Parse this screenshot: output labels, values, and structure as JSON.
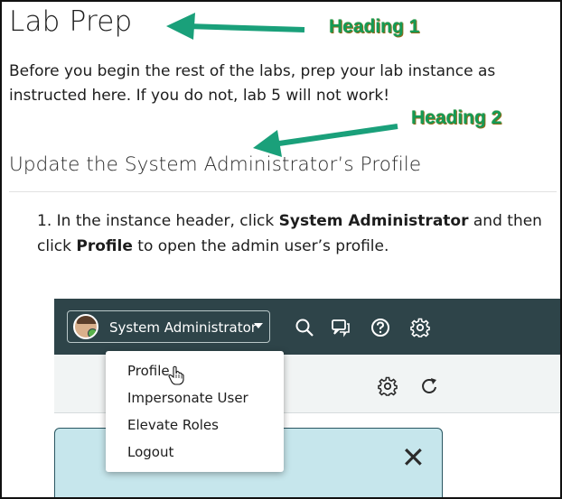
{
  "page": {
    "heading1": "Lab Prep",
    "intro": "Before you begin the rest of the labs, prep your lab instance as instructed here. If you do not, lab 5 will not work!",
    "heading2": "Update the System Administrator’s Profile",
    "step": {
      "number": "1.",
      "text_1": "In the instance header, click ",
      "bold_1": "System Administrator",
      "text_2": " and then click ",
      "bold_2": "Profile",
      "text_3": " to open the admin user’s profile."
    }
  },
  "callouts": {
    "heading1": "Heading 1",
    "heading2": "Heading 2",
    "arrow_color": "#1aa07a",
    "text_color": "#149a55"
  },
  "screenshot": {
    "user_label": "System Administrator",
    "header_bg": "#2e4449",
    "menu": [
      "Profile",
      "Impersonate User",
      "Elevate Roles",
      "Logout"
    ],
    "close_glyph": "✕",
    "icons": [
      "search-icon",
      "chat-icon",
      "help-icon",
      "gear-icon",
      "refresh-icon"
    ]
  }
}
